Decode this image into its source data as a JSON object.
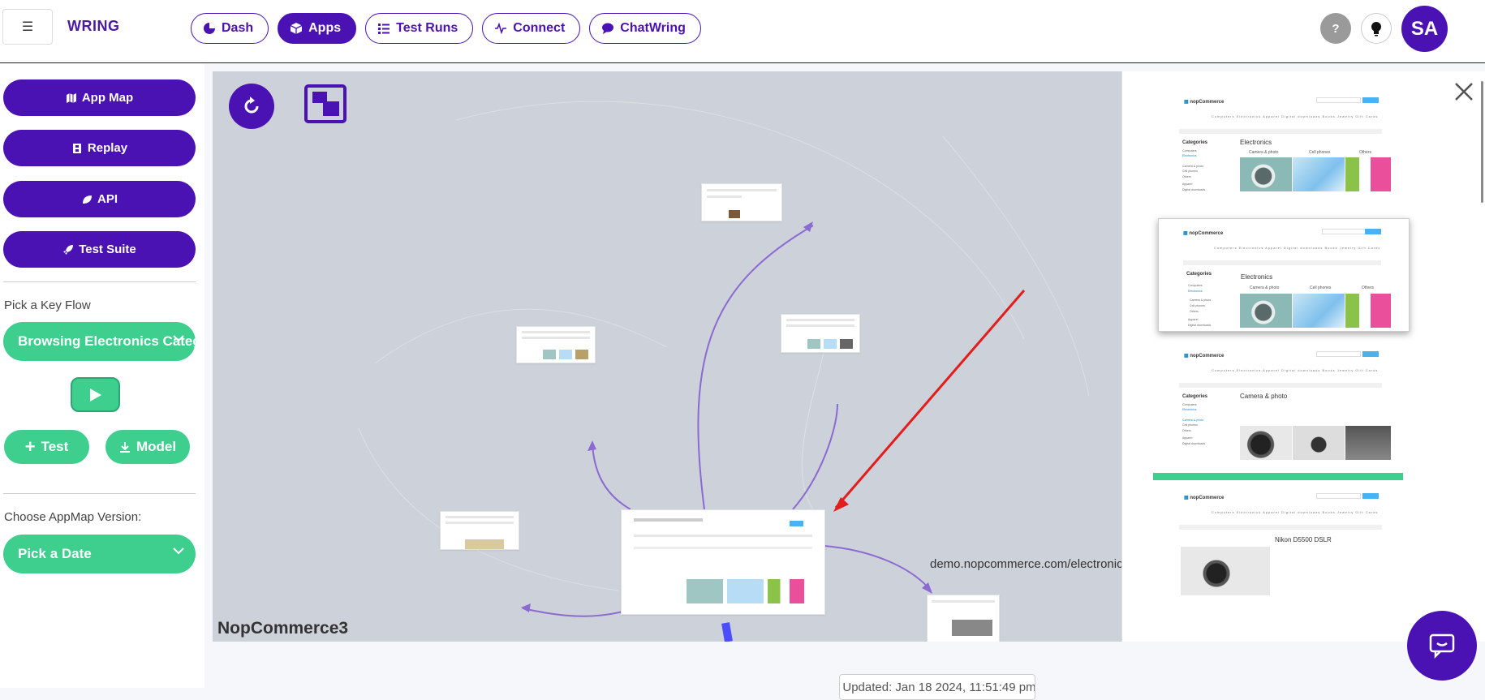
{
  "header": {
    "brand": "WRING",
    "nav": [
      {
        "label": "Dash",
        "icon": "pie-chart-icon",
        "active": false
      },
      {
        "label": "Apps",
        "icon": "cube-icon",
        "active": true
      },
      {
        "label": "Test Runs",
        "icon": "list-icon",
        "active": false
      },
      {
        "label": "Connect",
        "icon": "pulse-icon",
        "active": false
      },
      {
        "label": "ChatWring",
        "icon": "chat-bubble-icon",
        "active": false
      }
    ],
    "help": "?",
    "user_initials": "SA"
  },
  "sidebar": {
    "buttons": [
      {
        "label": "App Map",
        "icon": "map-icon"
      },
      {
        "label": "Replay",
        "icon": "film-icon"
      },
      {
        "label": "API",
        "icon": "leaf-icon"
      },
      {
        "label": "Test Suite",
        "icon": "rocket-icon"
      }
    ],
    "key_flow_label": "Pick a Key Flow",
    "key_flow_value": "Browsing Electronics Category",
    "test_label": "Test",
    "model_label": "Model",
    "version_label": "Choose AppMap Version:",
    "version_value": "Pick a Date"
  },
  "map": {
    "title": "NopCommerce3",
    "url": "demo.nopcommerce.com/electronics"
  },
  "panel": {
    "shots": [
      {
        "page": "Electronics",
        "subs": [
          "Camera & photo",
          "Cell phones",
          "Others"
        ]
      },
      {
        "page": "Electronics",
        "subs": [
          "Camera & photo",
          "Cell phones",
          "Others"
        ]
      },
      {
        "page": "Camera & photo",
        "subs": []
      },
      {
        "page": "Nikon D5500 DSLR",
        "subs": []
      }
    ],
    "categories_heading": "Categories",
    "logo_text": "nopCommerce",
    "menu_text": "Computers  Electronics  Apparel  Digital downloads  Books  Jewelry  Gift Cards"
  },
  "footer": {
    "updated": "Updated: Jan 18 2024, 11:51:49 pm"
  },
  "colors": {
    "primary": "#4b12b3",
    "green": "#3ecf8e",
    "arrow": "#e41c1c"
  }
}
